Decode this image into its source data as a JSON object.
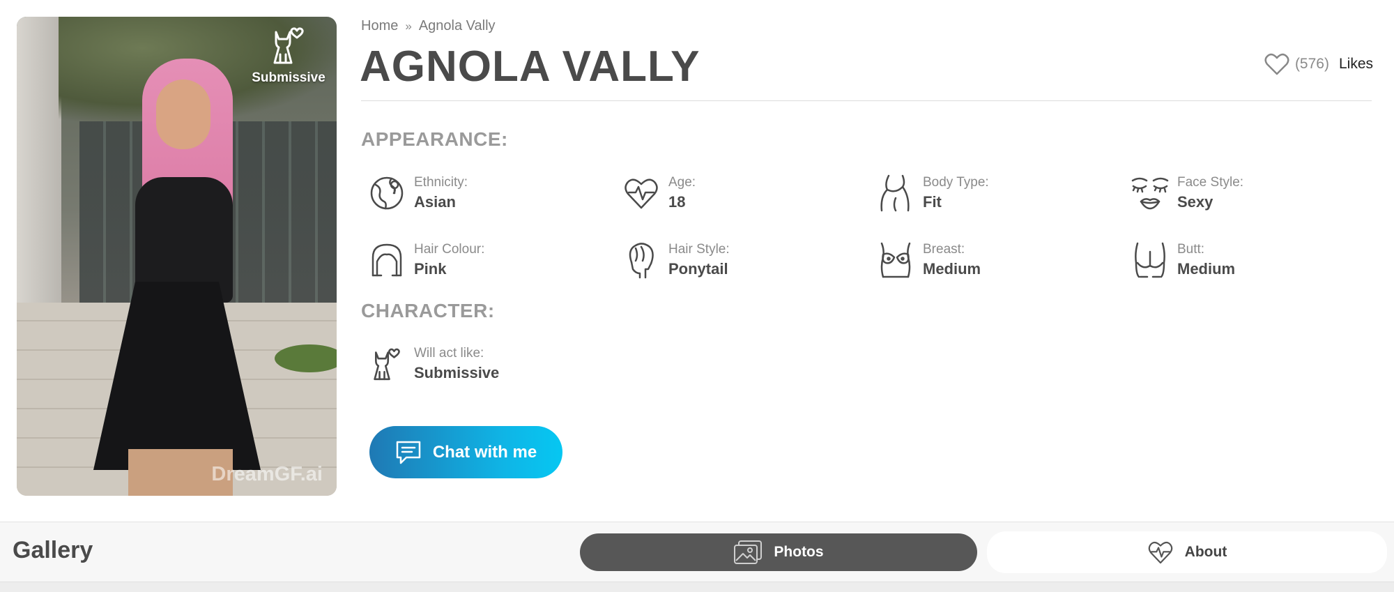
{
  "profile": {
    "badge": "Submissive",
    "watermark": "DreamGF.ai",
    "name": "AGNOLA VALLY"
  },
  "breadcrumb": {
    "home": "Home",
    "separator": "»",
    "current": "Agnola Vally"
  },
  "likes": {
    "count": "(576)",
    "label": "Likes"
  },
  "appearance": {
    "title": "APPEARANCE:",
    "items": [
      {
        "key": "Ethnicity:",
        "value": "Asian",
        "icon": "globe-icon"
      },
      {
        "key": "Age:",
        "value": "18",
        "icon": "heart-pulse-icon"
      },
      {
        "key": "Body Type:",
        "value": "Fit",
        "icon": "body-type-icon"
      },
      {
        "key": "Face Style:",
        "value": "Sexy",
        "icon": "face-style-icon"
      },
      {
        "key": "Hair Colour:",
        "value": "Pink",
        "icon": "hair-colour-icon"
      },
      {
        "key": "Hair Style:",
        "value": "Ponytail",
        "icon": "hair-style-icon"
      },
      {
        "key": "Breast:",
        "value": "Medium",
        "icon": "breast-icon"
      },
      {
        "key": "Butt:",
        "value": "Medium",
        "icon": "butt-icon"
      }
    ]
  },
  "character": {
    "title": "CHARACTER:",
    "items": [
      {
        "key": "Will act like:",
        "value": "Submissive",
        "icon": "cat-heart-icon"
      }
    ]
  },
  "chat_button": {
    "label": "Chat with me"
  },
  "gallery": {
    "title": "Gallery",
    "tabs": [
      {
        "label": "Photos",
        "active": true
      },
      {
        "label": "About",
        "active": false
      }
    ]
  },
  "colors": {
    "accent_start": "#1f79b4",
    "accent_end": "#06c7f2",
    "tab_active": "#575757"
  }
}
